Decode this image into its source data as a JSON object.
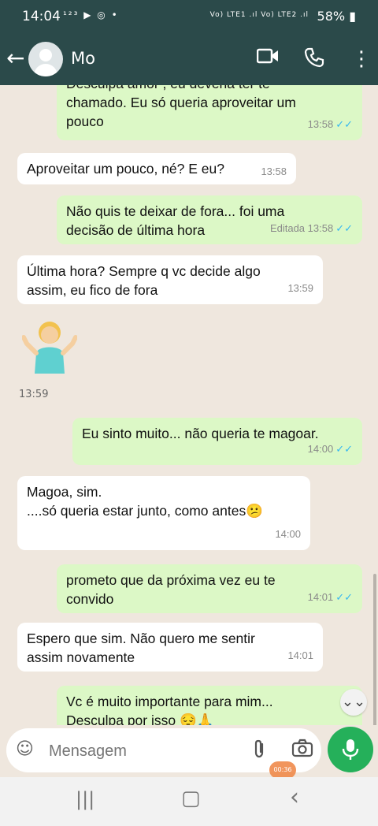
{
  "statusbar": {
    "time": "14:04",
    "left_icons": "¹²³ ▶ ◎ •",
    "network": "Vo) LTE1 .ıl Vo) LTE2 .ıl",
    "battery": "58%"
  },
  "header": {
    "contact_name": "Mo"
  },
  "messages": [
    {
      "dir": "out",
      "text": "Desculpa amor , eu deveria ter te chamado. Eu só queria aproveitar um pouco",
      "time": "13:58",
      "ticks": "✓✓"
    },
    {
      "dir": "in",
      "text": "Aproveitar um pouco, né? E eu?",
      "time": "13:58"
    },
    {
      "dir": "out",
      "text": "Não quis te deixar de fora... foi uma decisão de última hora",
      "edited": "Editada",
      "time": "13:58",
      "ticks": "✓✓"
    },
    {
      "dir": "in",
      "text": "Última hora? Sempre q vc decide algo assim, eu fico de fora",
      "time": "13:59"
    },
    {
      "dir": "in",
      "text": "🤷‍♀️",
      "time": "13:59"
    },
    {
      "dir": "out",
      "text": "Eu sinto muito... não queria te magoar.",
      "time": "14:00",
      "ticks": "✓✓"
    },
    {
      "dir": "in",
      "text": "Magoa, sim.\n....só queria estar junto, como antes😕",
      "time": "14:00"
    },
    {
      "dir": "out",
      "text": "prometo que da próxima vez eu te convido",
      "time": "14:01",
      "ticks": "✓✓"
    },
    {
      "dir": "in",
      "text": "Espero que sim. Não quero me sentir assim novamente",
      "time": "14:01"
    },
    {
      "dir": "out",
      "text": "Vc é muito importante para mim... Desculpa por isso 😔🙏",
      "time": "",
      "ticks": ""
    }
  ],
  "input": {
    "placeholder": "Mensagem",
    "rec_label": "00:36"
  },
  "icons": {
    "back": "←",
    "video": "▭▶",
    "call": "✆",
    "menu": "⋮",
    "emoji": "☺",
    "clip": "📎",
    "camera": "📷",
    "mic": "🎤",
    "scroll_down": "⌄⌄",
    "nav_recent": "|||",
    "nav_home": "▢",
    "nav_back": "‹"
  },
  "colors": {
    "header_bg": "#2b4a4a",
    "outgoing_bubble": "#dcf8c6",
    "incoming_bubble": "#ffffff",
    "read_ticks": "#34b7f1",
    "mic_button": "#25b05a"
  }
}
